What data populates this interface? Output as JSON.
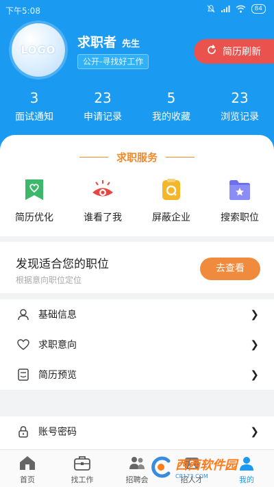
{
  "status_bar": {
    "time": "下午5:08",
    "battery": "84"
  },
  "profile": {
    "logo_text": "LOGO",
    "name": "求职者",
    "title": "先生",
    "status": "公开-寻找好工作",
    "refresh_label": "简历刷新"
  },
  "stats": [
    {
      "count": "3",
      "label": "面试通知"
    },
    {
      "count": "23",
      "label": "申请记录"
    },
    {
      "count": "5",
      "label": "我的收藏"
    },
    {
      "count": "23",
      "label": "浏览记录"
    }
  ],
  "services": {
    "title": "求职服务",
    "items": [
      {
        "label": "简历优化",
        "icon": "resume-optimize-icon",
        "color": "#3bb86a"
      },
      {
        "label": "谁看了我",
        "icon": "eye-icon",
        "color": "#e8473f"
      },
      {
        "label": "屏蔽企业",
        "icon": "block-company-icon",
        "color": "#f5b72a"
      },
      {
        "label": "搜索职位",
        "icon": "search-job-icon",
        "color": "#6b6ff0"
      }
    ]
  },
  "recommend": {
    "title": "发现适合您的职位",
    "subtitle": "根据意向职位定位",
    "button": "去查看"
  },
  "menu": [
    {
      "label": "基础信息",
      "icon": "user-icon"
    },
    {
      "label": "求职意向",
      "icon": "heart-icon"
    },
    {
      "label": "简历预览",
      "icon": "resume-preview-icon"
    }
  ],
  "menu2": [
    {
      "label": "账号密码",
      "icon": "lock-icon"
    }
  ],
  "bottom_nav": [
    {
      "label": "首页",
      "icon": "home-icon"
    },
    {
      "label": "找工作",
      "icon": "briefcase-icon"
    },
    {
      "label": "招聘会",
      "icon": "job-fair-icon"
    },
    {
      "label": "招人才",
      "icon": "talent-icon"
    },
    {
      "label": "我的",
      "icon": "profile-icon"
    }
  ],
  "watermark": {
    "text": "西西软件园",
    "sub": "CR173.COM"
  },
  "colors": {
    "primary": "#1a9af0",
    "refresh": "#e9524d",
    "accent": "#f08a2d"
  }
}
